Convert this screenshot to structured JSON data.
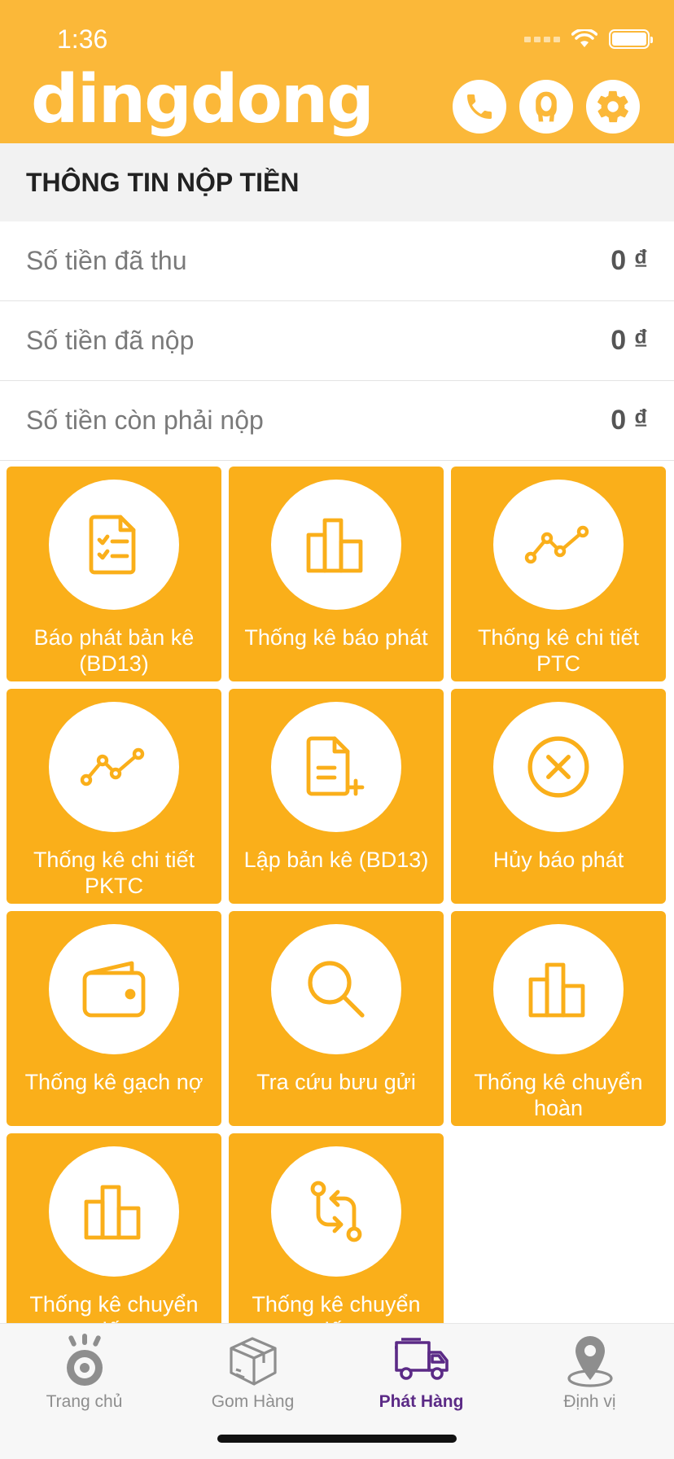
{
  "status_bar": {
    "time": "1:36"
  },
  "header": {
    "logo_text": "dingdong",
    "icons": [
      "phone-icon",
      "user-icon",
      "gear-icon"
    ],
    "background_color": "#FBB839"
  },
  "section_title": "THÔNG TIN NỘP TIỀN",
  "money_rows": [
    {
      "label": "Số tiền đã thu",
      "value": "0 ₫"
    },
    {
      "label": "Số tiền đã nộp",
      "value": "0 ₫"
    },
    {
      "label": "Số tiền còn phải nộp",
      "value": "0 ₫"
    }
  ],
  "tiles": [
    {
      "label": "Báo phát bản kê (BD13)",
      "icon": "document-checklist-icon"
    },
    {
      "label": "Thống kê báo phát",
      "icon": "bar-chart-icon"
    },
    {
      "label": "Thống kê chi tiết PTC",
      "icon": "line-chart-icon"
    },
    {
      "label": "Thống kê chi tiết PKTC",
      "icon": "line-chart-icon"
    },
    {
      "label": "Lập bản kê (BD13)",
      "icon": "document-add-icon"
    },
    {
      "label": "Hủy báo phát",
      "icon": "cancel-circle-icon"
    },
    {
      "label": "Thống kê gạch nợ",
      "icon": "wallet-icon"
    },
    {
      "label": "Tra cứu bưu gửi",
      "icon": "search-icon"
    },
    {
      "label": "Thống kê chuyển hoàn",
      "icon": "bar-chart-icon"
    },
    {
      "label": "Thống kê chuyển tiếp",
      "icon": "bar-chart-icon"
    },
    {
      "label": "Thống kê chuyển tiếp",
      "icon": "transfer-icon"
    }
  ],
  "tabbar": {
    "tabs": [
      {
        "label": "Trang chủ",
        "icon": "home-eye-icon",
        "active": false
      },
      {
        "label": "Gom Hàng",
        "icon": "package-box-icon",
        "active": false
      },
      {
        "label": "Phát Hàng",
        "icon": "delivery-truck-icon",
        "active": true
      },
      {
        "label": "Định vị",
        "icon": "location-pin-icon",
        "active": false
      }
    ]
  },
  "colors": {
    "accent": "#FAAF1A",
    "active_tab": "#5B2A86",
    "inactive_tab": "#8E8E8E"
  }
}
